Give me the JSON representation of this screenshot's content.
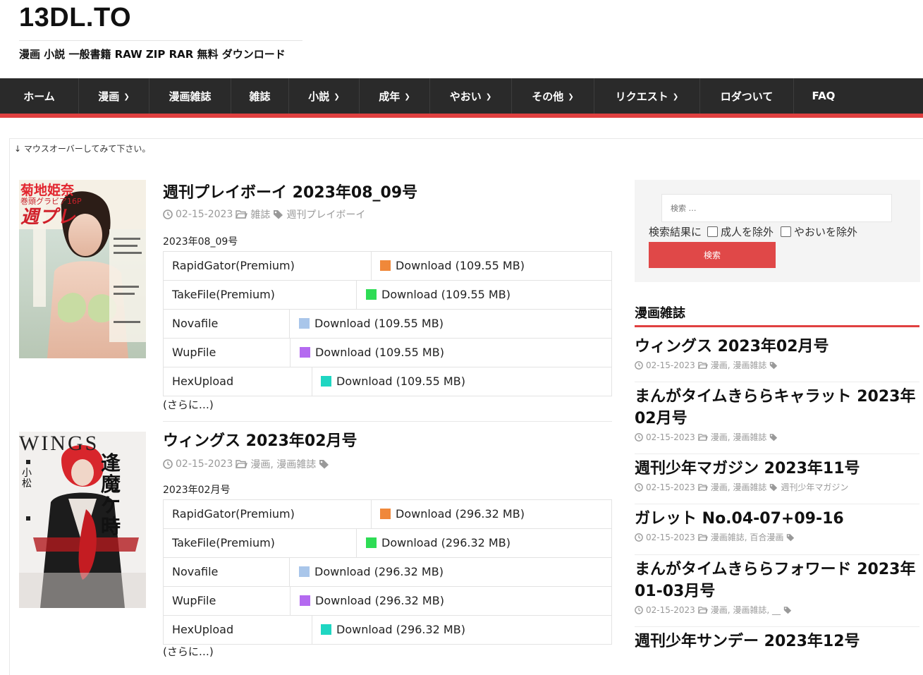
{
  "site": {
    "title": "13DL.TO",
    "tagline": "漫画 小説 一般書籍 RAW ZIP RAR 無料 ダウンロード"
  },
  "nav": [
    {
      "label": "ホーム",
      "caret": false
    },
    {
      "label": "漫画",
      "caret": true
    },
    {
      "label": "漫画雑誌",
      "caret": false
    },
    {
      "label": "雑誌",
      "caret": false
    },
    {
      "label": "小説",
      "caret": true
    },
    {
      "label": "成年",
      "caret": true
    },
    {
      "label": "やおい",
      "caret": true
    },
    {
      "label": "その他",
      "caret": true
    },
    {
      "label": "リクエスト",
      "caret": true
    },
    {
      "label": "ロダついて",
      "caret": false
    },
    {
      "label": "FAQ",
      "caret": false
    }
  ],
  "hint": "↓ マウスオーバーしてみて下さい。",
  "posts": [
    {
      "title": "週刊プレイボーイ 2023年08_09号",
      "date": "02-15-2023",
      "category": "雑誌",
      "tag": "週刊プレイボーイ",
      "issue": "2023年08_09号",
      "cover": {
        "brand": "週プレ",
        "headline": "菊地姫奈",
        "sub": "巻頭グラビア16P"
      },
      "downloads": [
        {
          "host": "RapidGator(Premium)",
          "link": "Download (109.55 MB)",
          "color": "#f0883a"
        },
        {
          "host": "TakeFile(Premium)",
          "link": "Download (109.55 MB)",
          "color": "#2edc55"
        },
        {
          "host": "Novafile",
          "link": "Download (109.55 MB)",
          "color": "#a9c6ea"
        },
        {
          "host": "WupFile",
          "link": "Download (109.55 MB)",
          "color": "#b46af0"
        },
        {
          "host": "HexUpload",
          "link": "Download (109.55 MB)",
          "color": "#1fd6c2"
        }
      ],
      "more": "(さらに…)"
    },
    {
      "title": "ウィングス 2023年02月号",
      "date": "02-15-2023",
      "category": "漫画, 漫画雑誌",
      "tag": "",
      "issue": "2023年02月号",
      "cover": {
        "brand": "WINGS",
        "headline": "逢魔ケ時",
        "sub": "小松"
      },
      "downloads": [
        {
          "host": "RapidGator(Premium)",
          "link": "Download (296.32 MB)",
          "color": "#f0883a"
        },
        {
          "host": "TakeFile(Premium)",
          "link": "Download (296.32 MB)",
          "color": "#2edc55"
        },
        {
          "host": "Novafile",
          "link": "Download (296.32 MB)",
          "color": "#a9c6ea"
        },
        {
          "host": "WupFile",
          "link": "Download (296.32 MB)",
          "color": "#b46af0"
        },
        {
          "host": "HexUpload",
          "link": "Download (296.32 MB)",
          "color": "#1fd6c2"
        }
      ],
      "more": "(さらに…)"
    }
  ],
  "search": {
    "placeholder": "検索 …",
    "filter_label": "検索結果に",
    "exclude_adult": "成人を除外",
    "exclude_yaoi": "やおいを除外",
    "button": "検索"
  },
  "sidebar": {
    "widget_title": "漫画雑誌",
    "posts": [
      {
        "title": "ウィングス 2023年02月号",
        "date": "02-15-2023",
        "category": "漫画, 漫画雑誌",
        "tag": ""
      },
      {
        "title": "まんがタイムきららキャラット 2023年02月号",
        "date": "02-15-2023",
        "category": "漫画, 漫画雑誌",
        "tag": ""
      },
      {
        "title": "週刊少年マガジン 2023年11号",
        "date": "02-15-2023",
        "category": "漫画, 漫画雑誌",
        "tag": "週刊少年マガジン"
      },
      {
        "title": "ガレット No.04-07+09-16",
        "date": "02-15-2023",
        "category": "漫画雑誌, 百合漫画",
        "tag": ""
      },
      {
        "title": "まんがタイムきららフォワード 2023年01-03月号",
        "date": "02-15-2023",
        "category": "漫画, 漫画雑誌, __",
        "tag": ""
      },
      {
        "title": "週刊少年サンデー 2023年12号",
        "date": "",
        "category": "",
        "tag": ""
      }
    ]
  },
  "colors": {
    "accent": "#e04040",
    "nav_bg": "#2a2a2a",
    "meta_text": "#999999"
  }
}
